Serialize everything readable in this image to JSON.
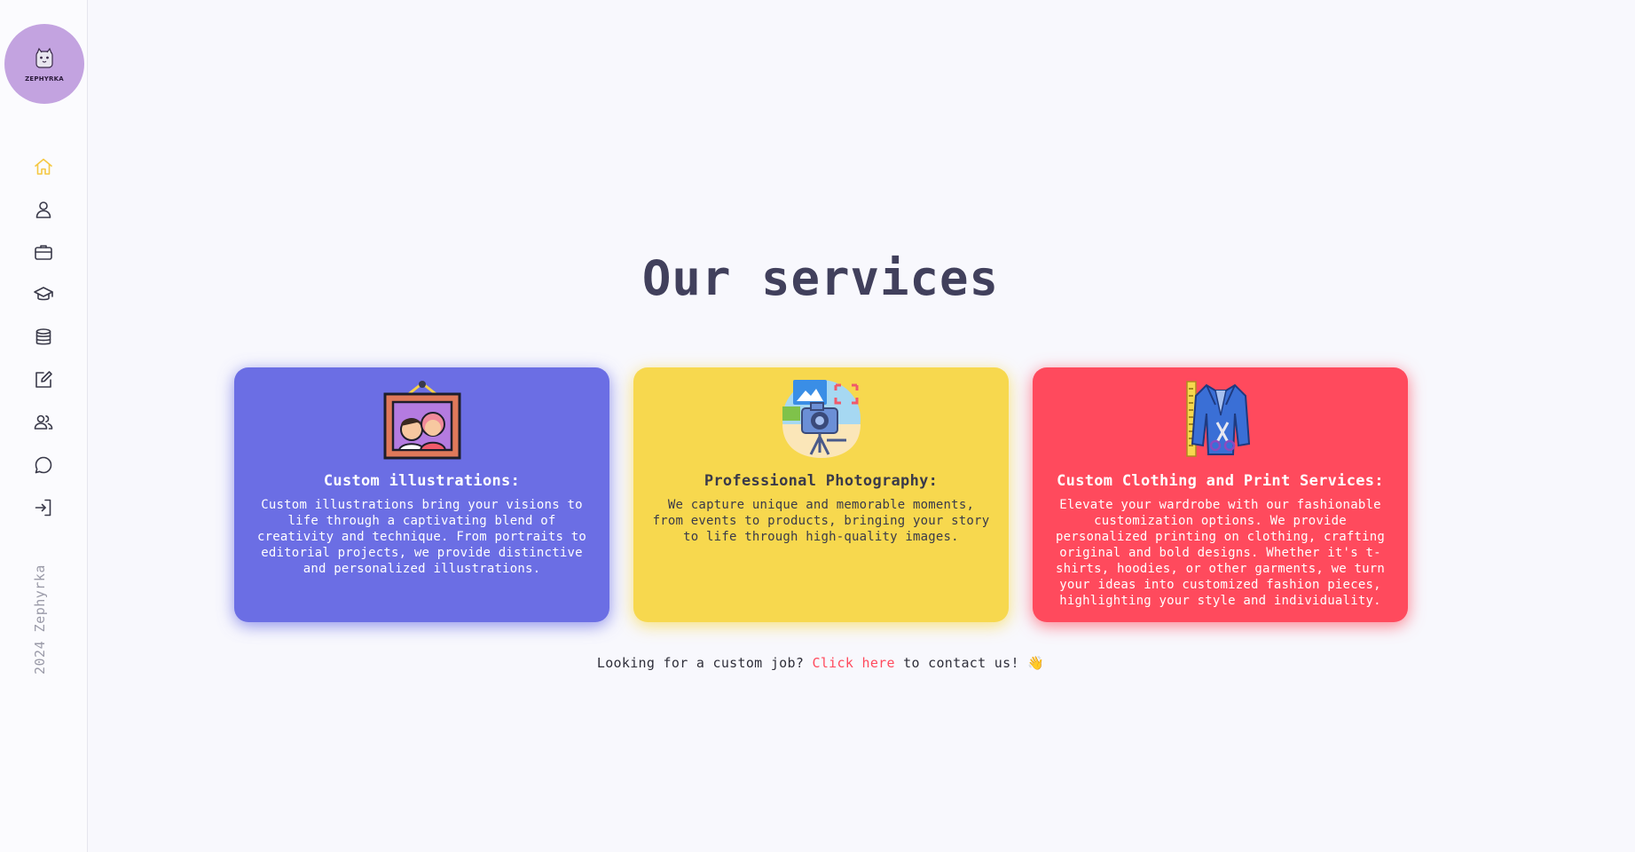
{
  "brand": {
    "logo_text": "ZEPHYRKA",
    "copyright": "2024 Zephyrka",
    "logo_color": "#c3a3e0"
  },
  "sidebar": {
    "items": [
      {
        "icon": "home-icon",
        "active": true
      },
      {
        "icon": "user-icon",
        "active": false
      },
      {
        "icon": "briefcase-icon",
        "active": false
      },
      {
        "icon": "graduation-cap-icon",
        "active": false
      },
      {
        "icon": "database-icon",
        "active": false
      },
      {
        "icon": "edit-icon",
        "active": false
      },
      {
        "icon": "users-icon",
        "active": false
      },
      {
        "icon": "chat-icon",
        "active": false
      },
      {
        "icon": "login-icon",
        "active": false
      }
    ],
    "active_color": "#f5c842"
  },
  "page": {
    "title": "Our services"
  },
  "services": [
    {
      "title": "Custom illustrations:",
      "description": "Custom illustrations bring your visions to life through a captivating blend of creativity and technique. From portraits to editorial projects, we provide distinctive and personalized illustrations.",
      "color": "#6b6ee4",
      "icon": "picture-frame-icon"
    },
    {
      "title": "Professional Photography:",
      "description": "We capture unique and memorable moments, from events to products, bringing your story to life through high-quality images.",
      "color": "#f7d84e",
      "icon": "camera-icon"
    },
    {
      "title": "Custom Clothing and Print Services:",
      "description": "Elevate your wardrobe with our fashionable customization options. We provide personalized printing on clothing, crafting original and bold designs. Whether it's t-shirts, hoodies, or other garments, we turn your ideas into customized fashion pieces, highlighting your style and individuality.",
      "color": "#ff4a5d",
      "icon": "jacket-icon"
    }
  ],
  "contact": {
    "prefix": "Looking for a custom job? ",
    "link_text": "Click here",
    "suffix": " to contact us! ",
    "emoji": "👋"
  }
}
